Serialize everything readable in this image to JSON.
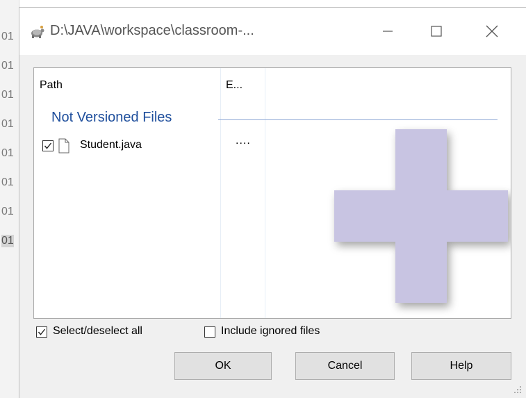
{
  "background": {
    "line_numbers": [
      "01",
      "01",
      "01",
      "01",
      "01",
      "01",
      "01",
      "01"
    ]
  },
  "window": {
    "title": "D:\\JAVA\\workspace\\classroom-...",
    "app_icon": "tortoise-icon",
    "controls": {
      "minimize": "minimize-icon",
      "maximize": "maximize-icon",
      "close": "close-icon"
    }
  },
  "list": {
    "columns": [
      "Path",
      "E..."
    ],
    "group_label": "Not Versioned Files",
    "rows": [
      {
        "checked": true,
        "icon": "file-icon",
        "name": "Student.java",
        "ext": "...."
      }
    ],
    "overlay_icon": "plus-icon"
  },
  "options": {
    "select_all": {
      "label": "Select/deselect all",
      "checked": true
    },
    "include_ignored": {
      "label": "Include ignored files",
      "checked": false
    }
  },
  "buttons": {
    "ok": "OK",
    "cancel": "Cancel",
    "help": "Help"
  },
  "colors": {
    "group_label": "#1e4e9c",
    "plus_overlay": "#c8c4e2"
  }
}
